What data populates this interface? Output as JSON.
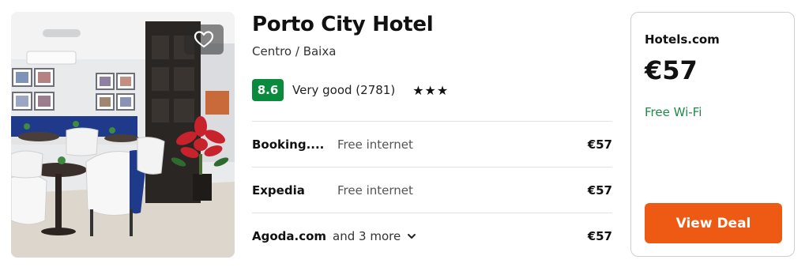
{
  "hotel": {
    "name": "Porto City Hotel",
    "location": "Centro / Baixa",
    "rating_score": "8.6",
    "rating_text": "Very good (2781)",
    "stars": "★★★",
    "favorite_icon": "heart-outline-icon"
  },
  "offers": [
    {
      "provider": "Booking....",
      "note": "Free internet",
      "price": "€57"
    },
    {
      "provider": "Expedia",
      "note": "Free internet",
      "price": "€57"
    },
    {
      "provider": "Agoda.com",
      "more": "and 3 more",
      "price": "€57"
    }
  ],
  "deal": {
    "provider": "Hotels.com",
    "price": "€57",
    "amenity": "Free Wi-Fi",
    "button_label": "View Deal"
  },
  "colors": {
    "score_badge": "#0a8a3c",
    "amenity_green": "#1e8a4a",
    "deal_button": "#ee5a14"
  }
}
